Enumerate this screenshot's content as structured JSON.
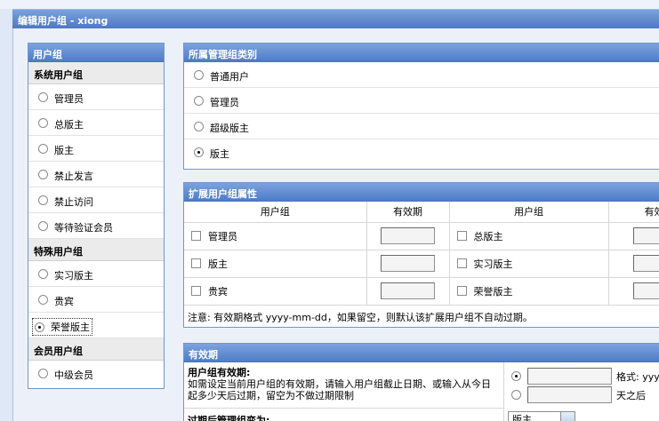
{
  "window": {
    "title": "编辑用户组 - xiong"
  },
  "left_panel": {
    "title": "用户组",
    "groups": [
      {
        "name": "系统用户组",
        "items": [
          {
            "label": "管理员",
            "checked": false
          },
          {
            "label": "总版主",
            "checked": false
          },
          {
            "label": "版主",
            "checked": false
          },
          {
            "label": "禁止发言",
            "checked": false
          },
          {
            "label": "禁止访问",
            "checked": false
          },
          {
            "label": "等待验证会员",
            "checked": false
          }
        ]
      },
      {
        "name": "特殊用户组",
        "items": [
          {
            "label": "实习版主",
            "checked": false
          },
          {
            "label": "贵宾",
            "checked": false
          },
          {
            "label": "荣誉版主",
            "checked": true
          }
        ]
      },
      {
        "name": "会员用户组",
        "items": [
          {
            "label": "中级会员",
            "checked": false
          }
        ]
      }
    ]
  },
  "admin_category": {
    "title": "所属管理组类别",
    "options": [
      {
        "label": "普通用户",
        "checked": false
      },
      {
        "label": "管理员",
        "checked": false
      },
      {
        "label": "超级版主",
        "checked": false
      },
      {
        "label": "版主",
        "checked": true
      }
    ]
  },
  "extended": {
    "title": "扩展用户组属性",
    "headers": [
      "用户组",
      "有效期",
      "用户组",
      "有效"
    ],
    "rows": [
      [
        "管理员",
        "总版主"
      ],
      [
        "版主",
        "实习版主"
      ],
      [
        "贵宾",
        "荣誉版主"
      ]
    ],
    "note": "注意: 有效期格式 yyyy-mm-dd，如果留空，则默认该扩展用户组不自动过期。"
  },
  "validity": {
    "title": "有效期",
    "label": "用户组有效期:",
    "description": "如需设定当前用户组的有效期，请输入用户组截止日期、或输入从今日起多少天后过期，留空为不做过期限制",
    "format_prefix": "格式: yyy",
    "days_suffix": "天之后",
    "after_label": "过期后管理组变为:",
    "select_value": "版主"
  }
}
